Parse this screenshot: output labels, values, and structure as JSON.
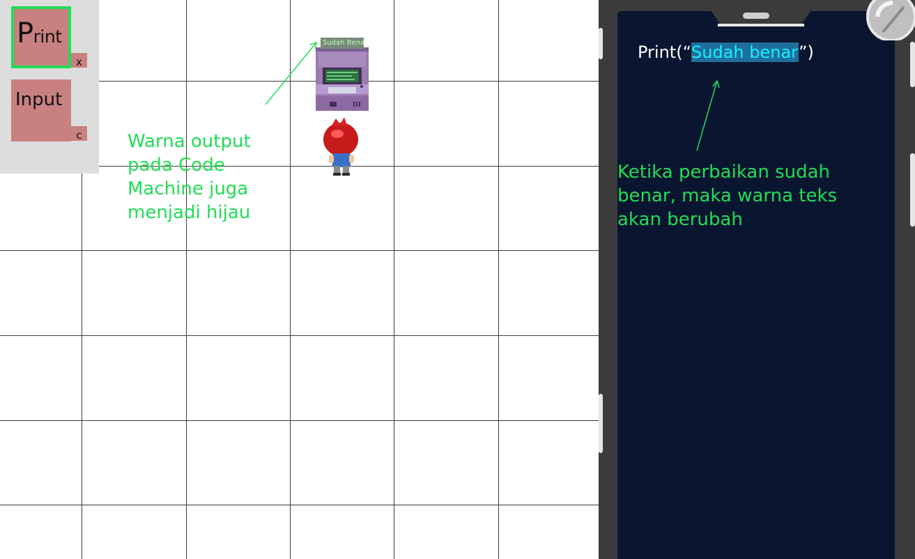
{
  "palette": {
    "print_block": {
      "label_first": "P",
      "label_rest": "rint",
      "slot": "x"
    },
    "input_block": {
      "label": "Input",
      "slot": "c"
    }
  },
  "game": {
    "machine_output": "Sudah Benar"
  },
  "annotations": {
    "left": [
      "Warna output",
      "pada Code",
      "Machine juga",
      "menjadi hijau"
    ],
    "right": [
      "Ketika perbaikan sudah",
      "benar, maka warna teks",
      "akan berubah"
    ]
  },
  "code_panel": {
    "prefix": "Print(“",
    "highlight": "Sudah benar",
    "suffix": "”)"
  },
  "colors": {
    "annotation": "#22dd55",
    "block": "#c98080",
    "selected_border": "#22dd55",
    "screen": "#0a1530",
    "highlight_text": "#16f0ff"
  }
}
